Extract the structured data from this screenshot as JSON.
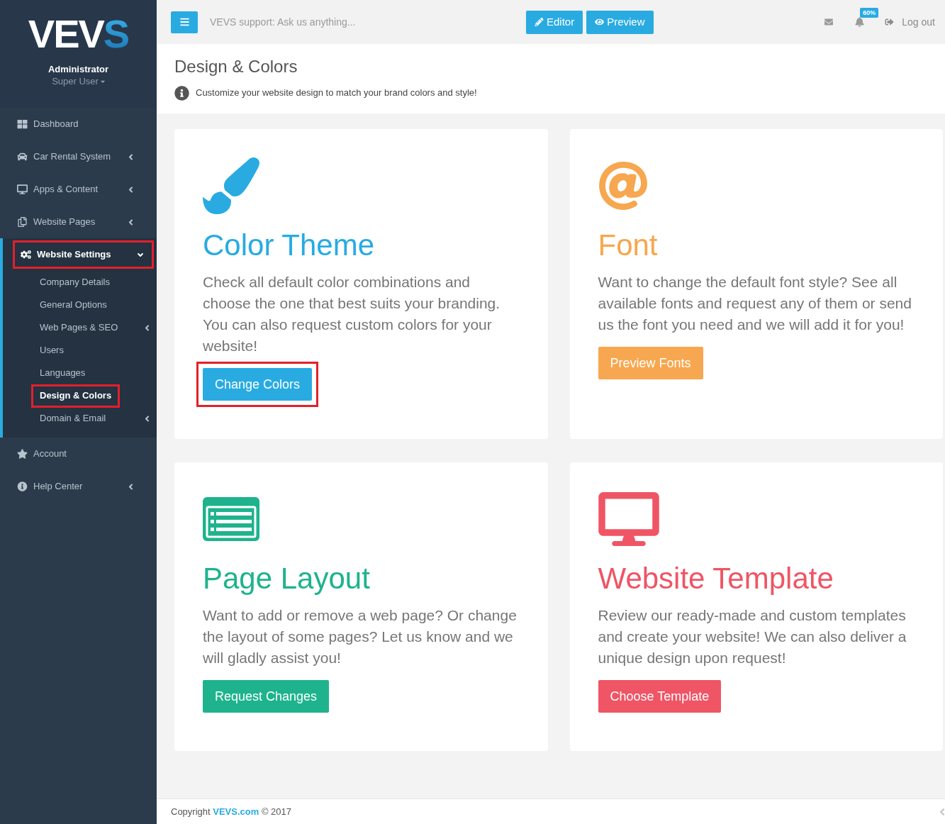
{
  "sidebar": {
    "logo": {
      "main": "VEV",
      "accent": "S"
    },
    "user": {
      "name": "Administrator",
      "role": "Super User"
    },
    "menu": [
      {
        "label": "Dashboard",
        "kind": "link",
        "selected": false,
        "highlighted": false
      },
      {
        "label": "Car Rental System",
        "kind": "submenu",
        "expanded": false,
        "selected": false,
        "highlighted": false
      },
      {
        "label": "Apps & Content",
        "kind": "submenu",
        "expanded": false,
        "selected": false,
        "highlighted": false
      },
      {
        "label": "Website Pages",
        "kind": "submenu",
        "expanded": false,
        "selected": false,
        "highlighted": false
      },
      {
        "label": "Website Settings",
        "kind": "submenu",
        "expanded": true,
        "selected": true,
        "highlighted": true,
        "children": [
          {
            "label": "Company Details",
            "kind": "link",
            "selected": false,
            "highlighted": false
          },
          {
            "label": "General Options",
            "kind": "link",
            "selected": false,
            "highlighted": false
          },
          {
            "label": "Web Pages & SEO",
            "kind": "submenu",
            "expanded": false,
            "selected": false,
            "highlighted": false
          },
          {
            "label": "Users",
            "kind": "link",
            "selected": false,
            "highlighted": false
          },
          {
            "label": "Languages",
            "kind": "link",
            "selected": false,
            "highlighted": false
          },
          {
            "label": "Design & Colors",
            "kind": "link",
            "selected": true,
            "highlighted": true
          },
          {
            "label": "Domain & Email",
            "kind": "submenu",
            "expanded": false,
            "selected": false,
            "highlighted": false
          }
        ]
      },
      {
        "label": "Account",
        "kind": "link",
        "selected": false,
        "highlighted": false
      },
      {
        "label": "Help Center",
        "kind": "submenu",
        "expanded": false,
        "selected": false,
        "highlighted": false
      }
    ]
  },
  "top_bar": {
    "support_field": {
      "placeholder": "VEVS support: Ask us anything..."
    },
    "buttons": [
      {
        "label": "Editor"
      },
      {
        "label": "Preview"
      }
    ],
    "notification_badge": "60%",
    "logout": "Log out"
  },
  "page_header": {
    "title": "Design & Colors",
    "subtitle": "Customize your website design to match your brand colors and style!"
  },
  "cards": [
    {
      "title": "Color Theme",
      "text": "Check all default color combinations and choose the one that best suits your branding. You can also request custom colors for your website!",
      "button": "Change Colors",
      "color": "#29abe2",
      "highlighted": true
    },
    {
      "title": "Font",
      "text": "Want to change the default font style? See all available fonts and request any of them or send us the font you need and we will add it for you!",
      "button": "Preview Fonts",
      "color": "#f7a74f",
      "highlighted": false
    },
    {
      "title": "Page Layout",
      "text": "Want to add or remove a web page? Or change the layout of some pages? Let us know and we will gladly assist you!",
      "button": "Request Changes",
      "color": "#1eb38d",
      "highlighted": false
    },
    {
      "title": "Website Template",
      "text": "Review our ready-made and custom templates and create your website! We can also deliver a unique design upon request!",
      "button": "Choose Template",
      "color": "#ef5565",
      "highlighted": false
    }
  ],
  "footer": {
    "prefix": "Copyright",
    "link": "VEVS.com",
    "suffix": "© 2017"
  }
}
